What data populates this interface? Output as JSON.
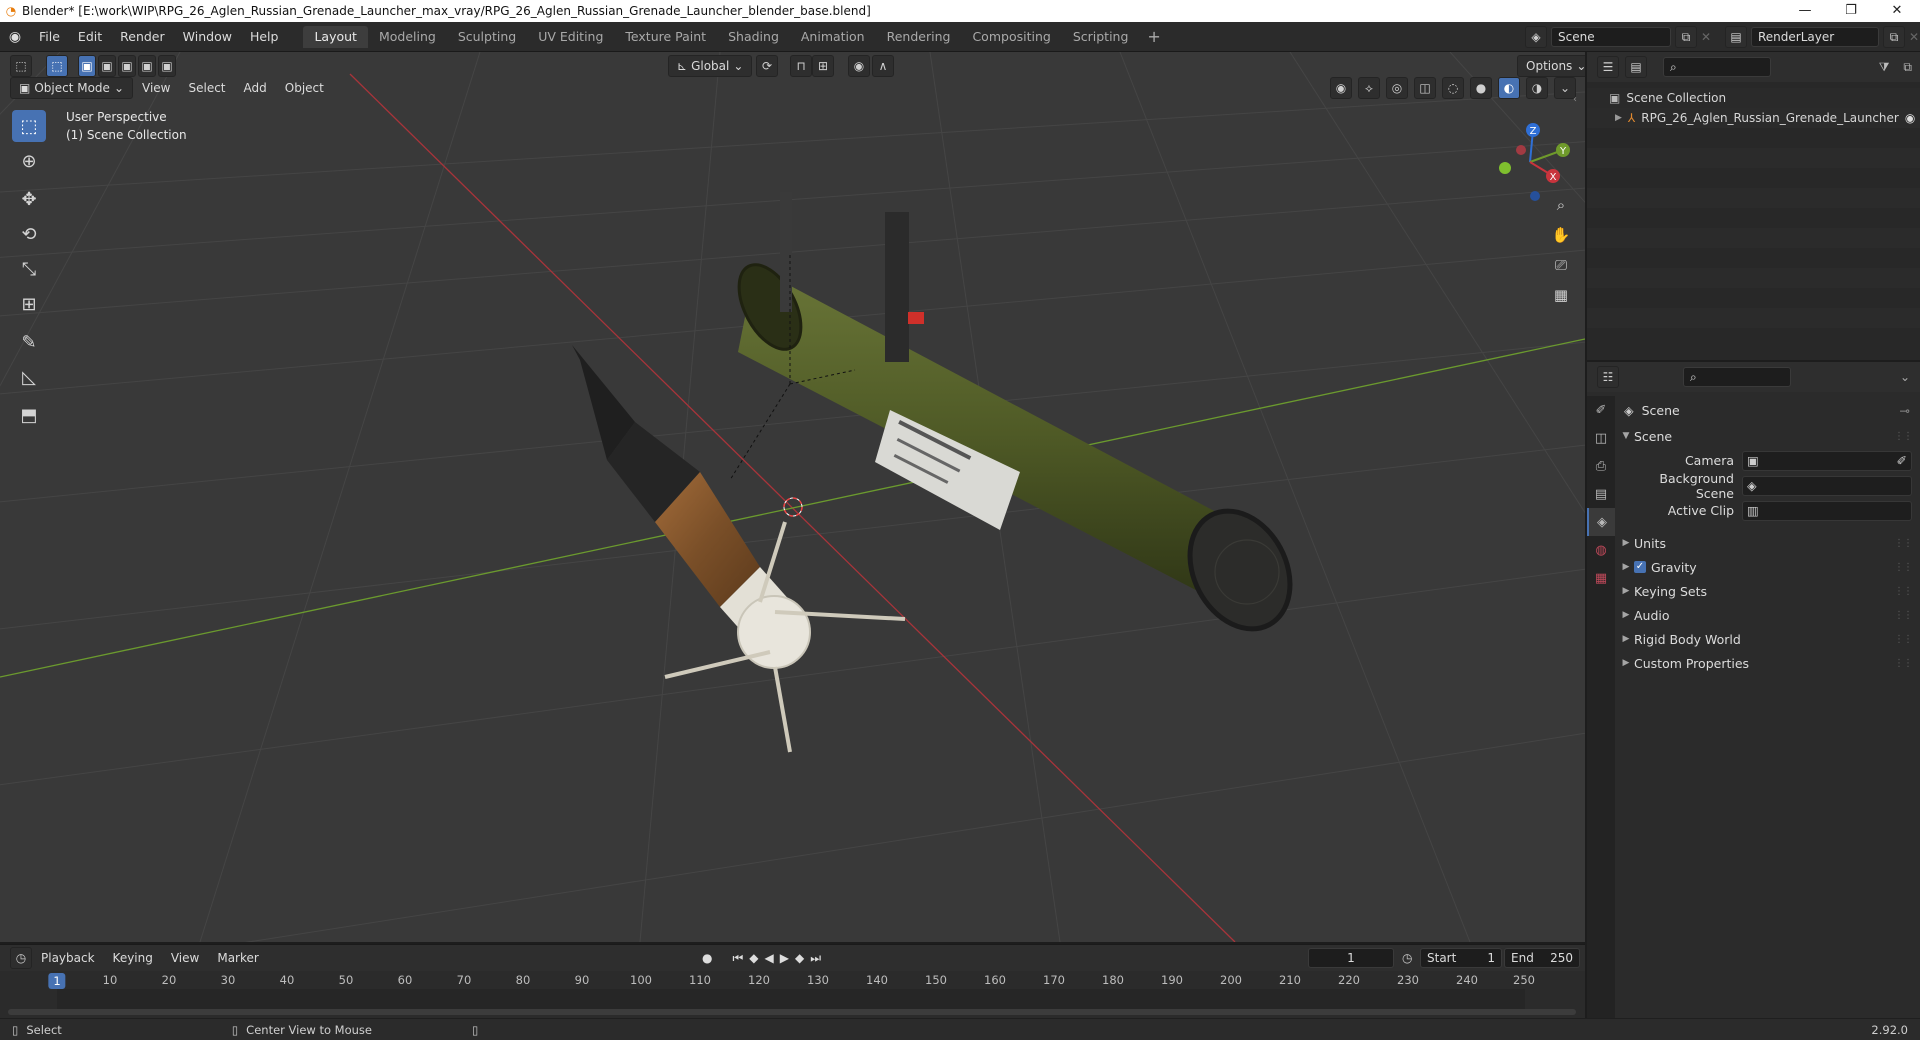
{
  "titlebar": {
    "title": "Blender* [E:\\work\\WIP\\RPG_26_Aglen_Russian_Grenade_Launcher_max_vray/RPG_26_Aglen_Russian_Grenade_Launcher_blender_base.blend]",
    "minimize": "—",
    "maximize": "❐",
    "close": "✕"
  },
  "menubar": {
    "items": [
      "File",
      "Edit",
      "Render",
      "Window",
      "Help"
    ],
    "workspaces": [
      "Layout",
      "Modeling",
      "Sculpting",
      "UV Editing",
      "Texture Paint",
      "Shading",
      "Animation",
      "Rendering",
      "Compositing",
      "Scripting"
    ],
    "active_workspace": "Layout",
    "add_workspace": "+",
    "scene_name": "Scene",
    "view_layer": "RenderLayer"
  },
  "viewport_header": {
    "transform_orientation": "Global",
    "options_label": "Options",
    "mode": "Object Mode",
    "menus": [
      "View",
      "Select",
      "Add",
      "Object"
    ]
  },
  "viewport": {
    "perspective_label": "User Perspective",
    "collection_label": "(1) Scene Collection",
    "gizmo_axes": {
      "x": "X",
      "y": "Y",
      "z": "Z"
    },
    "colors": {
      "background": "#393939",
      "grid": "#454545",
      "x_axis": "#a8343a",
      "y_axis": "#6b9a2e",
      "tube": "#4f5a26",
      "selection": "#4772b3"
    }
  },
  "outliner": {
    "root_label": "Scene Collection",
    "object_label": "RPG_26_Aglen_Russian_Grenade_Launcher"
  },
  "properties": {
    "context_title": "Scene",
    "panel_title": "Scene",
    "fields": [
      {
        "label": "Camera",
        "value": ""
      },
      {
        "label": "Background Scene",
        "value": ""
      },
      {
        "label": "Active Clip",
        "value": ""
      }
    ],
    "subpanels": [
      "Units",
      "Gravity",
      "Keying Sets",
      "Audio",
      "Rigid Body World",
      "Custom Properties"
    ],
    "gravity_checked": true
  },
  "timeline": {
    "menus": [
      "Playback",
      "Keying",
      "View",
      "Marker"
    ],
    "current_frame": "1",
    "start_label": "Start",
    "start_value": "1",
    "end_label": "End",
    "end_value": "250",
    "ruler": [
      "1",
      "10",
      "20",
      "30",
      "40",
      "50",
      "60",
      "70",
      "80",
      "90",
      "100",
      "110",
      "120",
      "130",
      "140",
      "150",
      "160",
      "170",
      "180",
      "190",
      "200",
      "210",
      "220",
      "230",
      "240",
      "250"
    ]
  },
  "statusbar": {
    "left_action": "Select",
    "mid_action": "Center View to Mouse",
    "version": "2.92.0"
  }
}
